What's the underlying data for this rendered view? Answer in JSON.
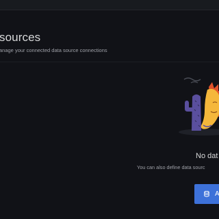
{
  "page": {
    "title": "sources",
    "subtitle": "anage your connected data source connections"
  },
  "empty_state": {
    "title": "No dat",
    "text": "You can also define data sourc",
    "add_button_label": "A",
    "add_button_icon": "database-icon",
    "illustration": "empty-state-cactus-sun-illustration"
  },
  "colors": {
    "background": "#111217",
    "primary": "#3d71d9",
    "sun": "#f5b73b",
    "cactus": "#5a4f9e"
  }
}
